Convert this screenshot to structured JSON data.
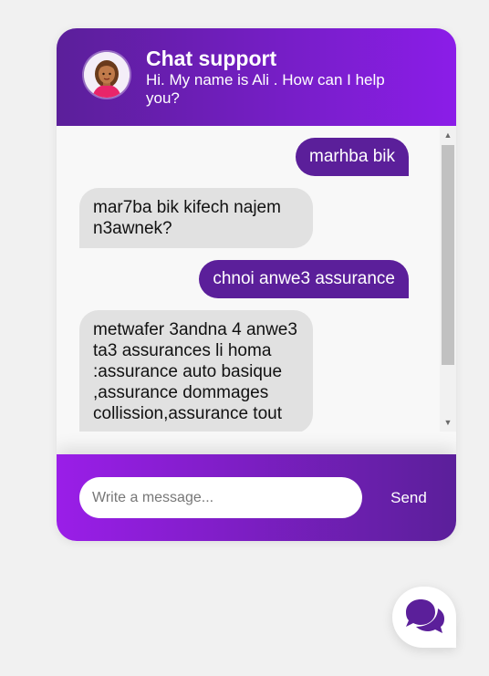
{
  "header": {
    "title": "Chat support",
    "subtitle": "Hi. My name is Ali . How can I help you?"
  },
  "messages": [
    {
      "from": "user",
      "text": "marhba bik"
    },
    {
      "from": "bot",
      "text": "mar7ba bik kifech najem n3awnek?"
    },
    {
      "from": "user",
      "text": "chnoi anwe3 assurance"
    },
    {
      "from": "bot",
      "text": "metwafer 3andna 4 anwe3 ta3 assurances li homa :assurance auto basique ,assurance dommages collission,assurance tout"
    }
  ],
  "footer": {
    "input_placeholder": "Write a message...",
    "input_value": "",
    "send_label": "Send"
  },
  "colors": {
    "primary": "#5b1f9a",
    "accent": "#9a1ee8",
    "bubble_in": "#e1e1e1"
  },
  "icons": {
    "avatar": "support-agent-avatar",
    "launcher": "comments-icon"
  }
}
